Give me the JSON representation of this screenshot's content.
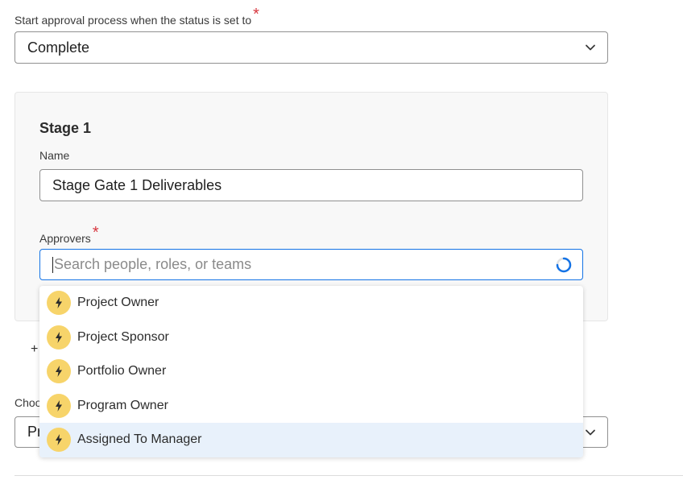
{
  "status_section": {
    "label": "Start approval process when the status is set to",
    "required_mark": "*",
    "selected_value": "Complete"
  },
  "stage": {
    "title": "Stage 1",
    "name_label": "Name",
    "name_value": "Stage Gate 1 Deliverables",
    "approvers_label": "Approvers",
    "approvers_required_mark": "*",
    "search_placeholder": "Search people, roles, or teams"
  },
  "add_stage": {
    "label": "+"
  },
  "choose_section": {
    "label_visible": "Choo",
    "select_visible": "Pr"
  },
  "dropdown": {
    "items": [
      {
        "label": "Project Owner",
        "icon": "bolt-icon"
      },
      {
        "label": "Project Sponsor",
        "icon": "bolt-icon"
      },
      {
        "label": "Portfolio Owner",
        "icon": "bolt-icon"
      },
      {
        "label": "Program Owner",
        "icon": "bolt-icon"
      },
      {
        "label": "Assigned To Manager",
        "icon": "bolt-icon",
        "highlighted": true
      }
    ]
  },
  "colors": {
    "required": "#d7373f",
    "focus_border": "#1473e6",
    "icon_bg": "#f7d46a",
    "highlight_bg": "#e8f1fb"
  }
}
